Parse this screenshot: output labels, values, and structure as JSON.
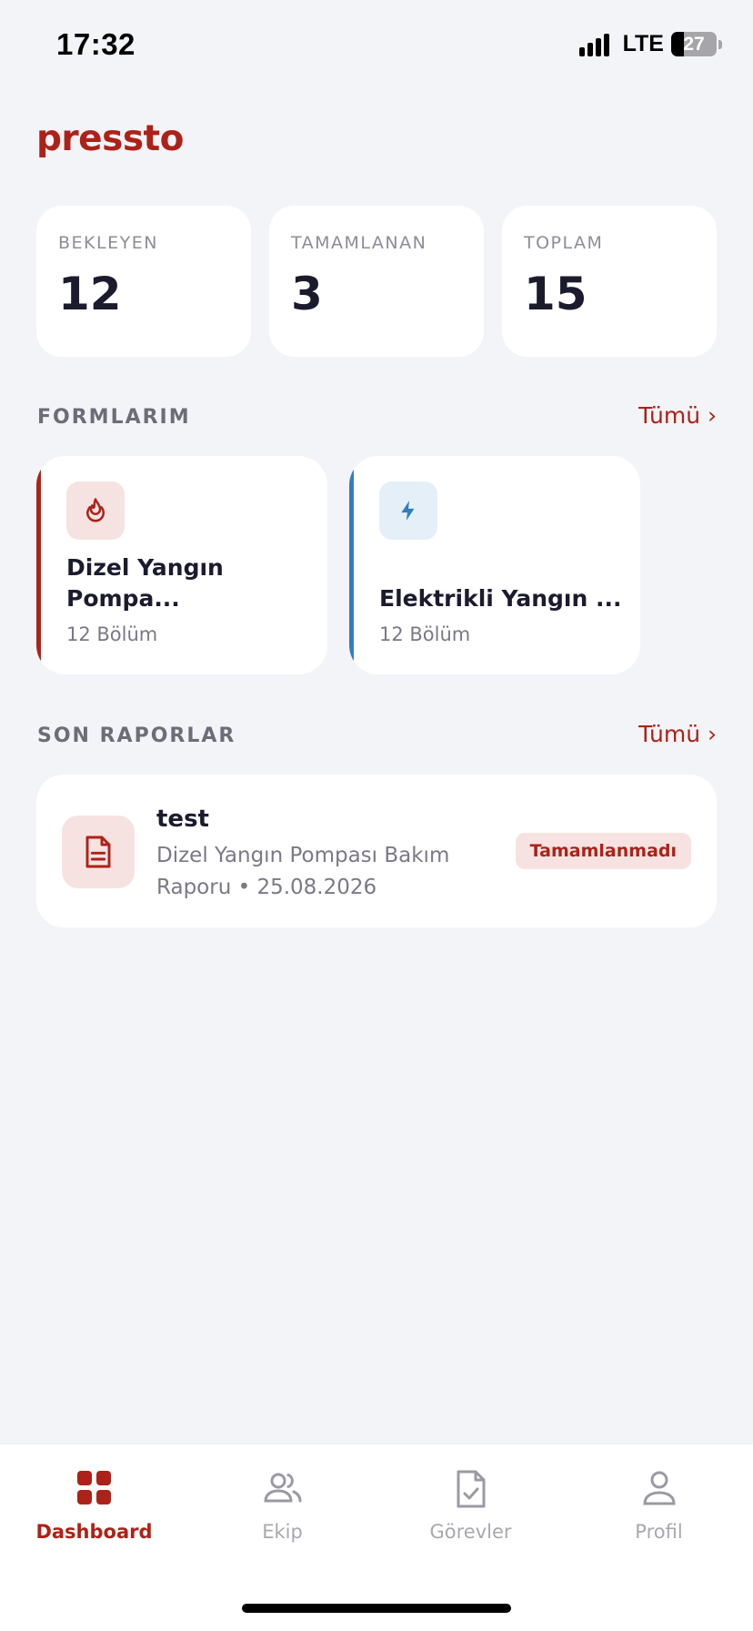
{
  "status_bar": {
    "time": "17:32",
    "network": "LTE",
    "battery": "27"
  },
  "app": {
    "logo": "pressto",
    "accent_color": "#ad2218",
    "blue_accent": "#2f7fbe"
  },
  "stats": [
    {
      "label": "BEKLEYEN",
      "value": "12"
    },
    {
      "label": "TAMAMLANAN",
      "value": "3"
    },
    {
      "label": "TOPLAM",
      "value": "15"
    }
  ],
  "forms_section": {
    "title": "FORMLARIM",
    "see_all": "Tümü ›",
    "items": [
      {
        "title_line1": "Dizel Yangın",
        "title_line2": "Pompa...",
        "subtitle": "12 Bölüm",
        "icon": "flame-icon"
      },
      {
        "title": "Elektrikli Yangın ...",
        "subtitle": "12 Bölüm",
        "icon": "bolt-icon"
      }
    ]
  },
  "reports_section": {
    "title": "SON RAPORLAR",
    "see_all": "Tümü ›",
    "items": [
      {
        "title": "test",
        "subtitle_line1": "Dizel Yangın Pompası Bakım",
        "subtitle_line2": "Raporu • 25.08.2026",
        "status": "Tamamlanmadı",
        "icon": "document-icon"
      }
    ]
  },
  "tabbar": {
    "tabs": [
      {
        "label": "Dashboard",
        "icon": "grid-icon",
        "active": true
      },
      {
        "label": "Ekip",
        "icon": "users-icon",
        "active": false
      },
      {
        "label": "Görevler",
        "icon": "clipboard-check-icon",
        "active": false
      },
      {
        "label": "Profil",
        "icon": "user-icon",
        "active": false
      }
    ]
  }
}
